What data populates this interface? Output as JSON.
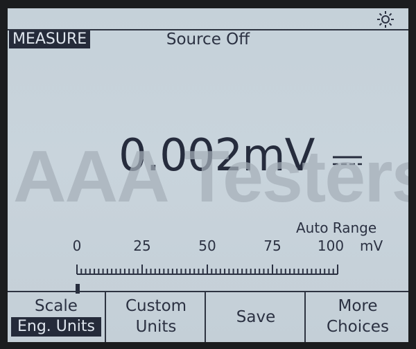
{
  "status_bar": {
    "brightness_icon": "sun-icon"
  },
  "mode": {
    "label": "MEASURE",
    "source_status": "Source Off"
  },
  "reading": {
    "value": "0.002",
    "unit": "mV",
    "dc_icon": "dc-symbol-icon"
  },
  "range": {
    "label": "Auto Range"
  },
  "scale": {
    "ticks": [
      "0",
      "25",
      "50",
      "75",
      "100"
    ],
    "unit": "mV",
    "min": 0,
    "max": 100,
    "level": 0.002
  },
  "softkeys": {
    "scale": {
      "line1": "Scale",
      "line2": "Eng. Units"
    },
    "custom_units": {
      "line1": "Custom",
      "line2": "Units"
    },
    "save": {
      "label": "Save"
    },
    "more_choices": {
      "line1": "More",
      "line2": "Choices"
    }
  },
  "watermark": {
    "text": "AAA Testers"
  },
  "colors": {
    "screen_bg": "#c7d2da",
    "ink": "#262c3d",
    "highlight_bg": "#252b3a"
  }
}
